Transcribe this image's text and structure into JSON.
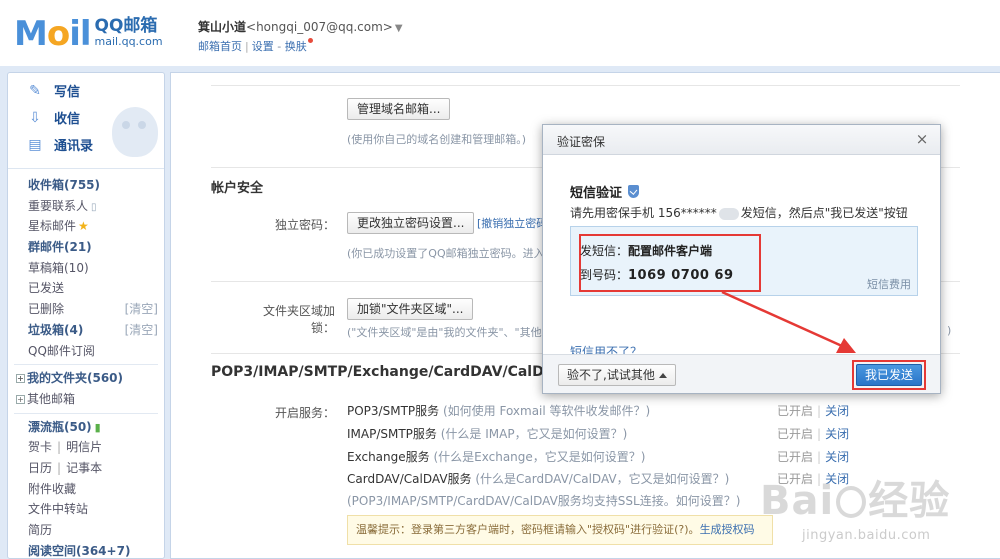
{
  "header": {
    "logo_text": "MOil",
    "logo_cn": "QQ邮箱",
    "logo_url": "mail.qq.com",
    "user_name": "箕山小道",
    "user_email": "<hongqi_007@qq.com>",
    "user_arrow": "▼",
    "link_home": "邮箱首页",
    "link_settings": "设置",
    "link_dash": "-",
    "link_skin": "换肤",
    "sep": "|"
  },
  "sidebar": {
    "quick": [
      {
        "label": "写信",
        "icon": "pencil-icon"
      },
      {
        "label": "收信",
        "icon": "inbox-download-icon"
      },
      {
        "label": "通讯录",
        "icon": "contacts-icon"
      }
    ],
    "folders": {
      "inbox": "收件箱(755)",
      "vip": "重要联系人",
      "starred": "星标邮件",
      "group": "群邮件(21)",
      "drafts": "草稿箱(10)",
      "sent": "已发送",
      "deleted": "已删除",
      "deleted_clear": "[清空]",
      "spam": "垃圾箱(4)",
      "spam_clear": "[清空]",
      "subscribe": "QQ邮件订阅",
      "my_folders": "我的文件夹(560)",
      "other_mail": "其他邮箱",
      "bottle": "漂流瓶(50)",
      "card": "贺卡",
      "postcard": "明信片",
      "calendar": "日历",
      "notes": "记事本",
      "attachments": "附件收藏",
      "transfer": "文件中转站",
      "resume": "简历",
      "reading": "阅读空间(364+7)"
    },
    "pair_sep": "|"
  },
  "main": {
    "domain_btn": "管理域名邮箱...",
    "domain_hint": "(使用你自己的域名创建和管理邮箱。)",
    "security_title": "帐户安全",
    "indep_label": "独立密码：",
    "indep_btn": "更改独立密码设置...",
    "indep_cancel": "[撤销独立密码",
    "indep_hint": "(你已成功设置了QQ邮箱独立密码。进入",
    "folder_label": "文件夹区域加锁：",
    "folder_btn": "加锁\"文件夹区域\"...",
    "folder_hint": "(\"文件夹区域\"是由\"我的文件夹\"、\"其他",
    "folder_hint_tail": ")",
    "pop_title": "POP3/IMAP/SMTP/Exchange/CardDAV/CalDAV",
    "services_label": "开启服务：",
    "services": [
      {
        "name": "POP3/SMTP服务",
        "help": "(如何使用 Foxmail 等软件收发邮件？)"
      },
      {
        "name": "IMAP/SMTP服务",
        "help": "(什么是 IMAP，它又是如何设置？)"
      },
      {
        "name": "Exchange服务",
        "help": "(什么是Exchange，它又是如何设置？)"
      },
      {
        "name": "CardDAV/CalDAV服务",
        "help": "(什么是CardDAV/CalDAV，它又是如何设置？)"
      }
    ],
    "ssl_note": "(POP3/IMAP/SMTP/CardDAV/CalDAV服务均支持SSL连接。如何设置？)",
    "status_on": "已开启",
    "status_sep": "|",
    "status_close": "关闭",
    "tip_text": "温馨提示：登录第三方客户端时，密码框请输入\"授权码\"进行验证",
    "tip_q": "?",
    "tip_gen": "生成授权码"
  },
  "dialog": {
    "title": "验证密保",
    "close": "×",
    "heading": "短信验证",
    "instr_pre": "请先用密保手机 156******",
    "instr_post": "发短信，然后点\"我已发送\"按钮",
    "sms_send_label": "发短信：",
    "sms_send_value": "配置邮件客户端",
    "sms_to_label": "到号码：",
    "sms_to_value": "1069 0700 69",
    "sms_fee": "短信费用",
    "cant_use": "短信用不了？",
    "other_btn": "验不了,试试其他",
    "send_btn": "我已发送"
  },
  "watermark": {
    "main_pre": "Bai",
    "main_post": "经验",
    "sub": "jingyan.baidu.com"
  },
  "colors": {
    "accent": "#2a75c8",
    "highlight_red": "#e53935",
    "sidebar_bg": "#dfe9f6"
  }
}
